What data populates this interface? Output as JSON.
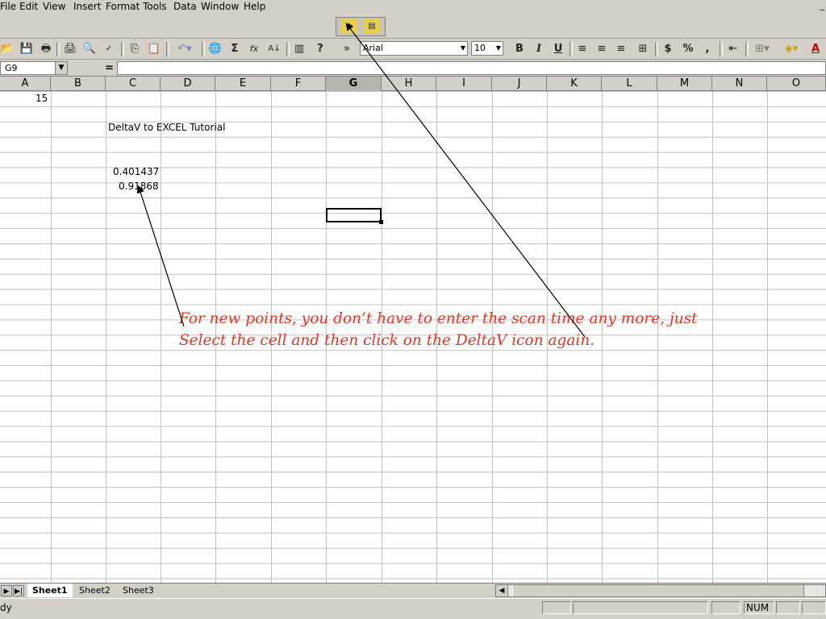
{
  "menu": {
    "file": "File",
    "edit": "Edit",
    "view": "View",
    "insert": "Insert",
    "format": "Format",
    "tools": "Tools",
    "data": "Data",
    "window": "Window",
    "help": "Help"
  },
  "window_controls": {
    "minimize": "_"
  },
  "toolbar": {
    "font_name": "Arial",
    "font_size": "10",
    "bold": "B",
    "italic": "I",
    "underline": "U",
    "currency": "$",
    "percent": "%",
    "comma": ",",
    "sum": "Σ",
    "function": "fx",
    "more": "»",
    "help": "?"
  },
  "formula_bar": {
    "name_box": "G9",
    "equals": "=",
    "value": ""
  },
  "columns": [
    "A",
    "B",
    "C",
    "D",
    "E",
    "F",
    "G",
    "H",
    "I",
    "J",
    "K",
    "L",
    "M",
    "N",
    "O"
  ],
  "active_column": "G",
  "cells": {
    "a1": "15",
    "c3": "DeltaV to EXCEL Tutorial",
    "c6": "0.401437",
    "c7": "0.91868"
  },
  "annotation": {
    "line1": "For new points, you don’t have to enter the scan time any more, just",
    "line2": "Select the cell and then click on the DeltaV icon again."
  },
  "sheets": [
    "Sheet1",
    "Sheet2",
    "Sheet3"
  ],
  "active_sheet": "Sheet1",
  "status": {
    "text": "dy",
    "num": "NUM"
  },
  "colors": {
    "annotation": "#e8331e",
    "chrome": "#d4d0c8",
    "gridline": "#c0c0c0"
  }
}
